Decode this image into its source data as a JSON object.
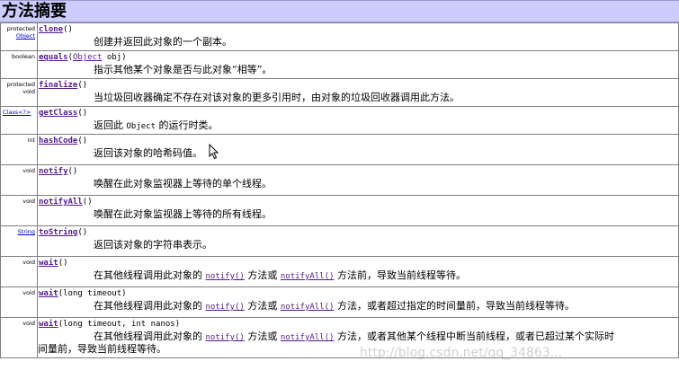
{
  "title": "方法摘要",
  "rows": [
    {
      "type_lines": [
        "protected"
      ],
      "type_link": "Object",
      "name": "clone",
      "params": "()",
      "desc": "创建并返回此对象的一个副本。"
    },
    {
      "type_lines": [
        "boolean"
      ],
      "type_link": "",
      "name": "equals",
      "params_pre": "(",
      "param_link": "Object",
      "params_post": " obj)",
      "desc": "指示其他某个对象是否与此对象“相等”。"
    },
    {
      "type_lines": [
        "protected",
        "void"
      ],
      "type_link": "",
      "name": "finalize",
      "params": "()",
      "desc": "当垃圾回收器确定不存在对该对象的更多引用时，由对象的垃圾回收器调用此方法。"
    },
    {
      "type_lines": [],
      "type_link": "Class<?>",
      "name": "getClass",
      "params": "()",
      "desc_pre": "返回此 ",
      "desc_code": "Object",
      "desc_post": " 的运行时类。"
    },
    {
      "type_lines": [
        "int"
      ],
      "type_link": "",
      "name": "hashCode",
      "params": "()",
      "desc": "返回该对象的哈希码值。"
    },
    {
      "type_lines": [
        "void"
      ],
      "type_link": "",
      "name": "notify",
      "params": "()",
      "desc": "唤醒在此对象监视器上等待的单个线程。"
    },
    {
      "type_lines": [
        "void"
      ],
      "type_link": "",
      "name": "notifyAll",
      "params": "()",
      "desc": "唤醒在此对象监视器上等待的所有线程。"
    },
    {
      "type_lines": [],
      "type_link": "String",
      "name": "toString",
      "params": "()",
      "desc": "返回该对象的字符串表示。"
    },
    {
      "type_lines": [
        "void"
      ],
      "type_link": "",
      "name": "wait",
      "params": "()",
      "desc_a": "在其他线程调用此对象的 ",
      "link1": "notify()",
      "desc_b": " 方法或 ",
      "link2": "notifyAll()",
      "desc_c": " 方法前，导致当前线程等待。"
    },
    {
      "type_lines": [
        "void"
      ],
      "type_link": "",
      "name": "wait",
      "params": "(long timeout)",
      "desc_a": "在其他线程调用此对象的 ",
      "link1": "notify()",
      "desc_b": " 方法或 ",
      "link2": "notifyAll()",
      "desc_c": " 方法，或者超过指定的时间量前，导致当前线程等待。"
    },
    {
      "type_lines": [
        "void"
      ],
      "type_link": "",
      "name": "wait",
      "params": "(long timeout, int nanos)",
      "desc_a": "在其他线程调用此对象的 ",
      "link1": "notify()",
      "desc_b": " 方法或 ",
      "link2": "notifyAll()",
      "desc_c": " 方法，或者其他某个线程中断当前线程，或者已超过某个实际时",
      "desc_line2": "间量前，导致当前线程等待。"
    }
  ],
  "watermark": "http://blog.csdn.net/qq_34863..."
}
